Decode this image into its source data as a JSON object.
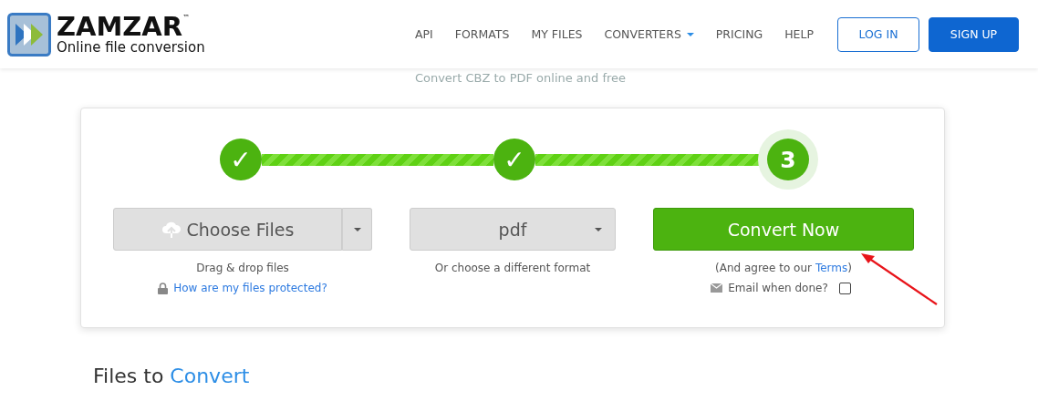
{
  "header": {
    "logo": {
      "name": "ZAMZAR",
      "trademark": "™",
      "tagline": "Online file conversion"
    },
    "nav": [
      {
        "label": "API",
        "dropdown": false
      },
      {
        "label": "FORMATS",
        "dropdown": false
      },
      {
        "label": "MY FILES",
        "dropdown": false
      },
      {
        "label": "CONVERTERS",
        "dropdown": true
      },
      {
        "label": "PRICING",
        "dropdown": false
      },
      {
        "label": "HELP",
        "dropdown": false
      }
    ],
    "buttons": [
      {
        "label": "LOG IN",
        "kind": "outline"
      },
      {
        "label": "SIGN UP",
        "kind": "solid"
      }
    ]
  },
  "subtitle": "Convert CBZ to PDF online and free",
  "steps": [
    {
      "label": "✓",
      "current": false
    },
    {
      "label": "✓",
      "current": false
    },
    {
      "label": "3",
      "current": true
    }
  ],
  "connectors": [
    {
      "level": 1
    },
    {
      "level": 1
    }
  ],
  "columns": [
    {
      "kind": "upload",
      "button": "Choose Files",
      "notes": [
        "Drag & drop files"
      ],
      "link": "How are my files protected?"
    },
    {
      "kind": "format",
      "button": "pdf",
      "notes": [
        "Or choose a different format"
      ]
    },
    {
      "kind": "convert",
      "button": "Convert Now",
      "agree": "(And agree to our",
      "terms": "Terms",
      "agree_end": ")",
      "email": "Email when done?",
      "email_checked": false
    }
  ],
  "section_heading": {
    "text": "Files to",
    "highlight": "Convert"
  }
}
